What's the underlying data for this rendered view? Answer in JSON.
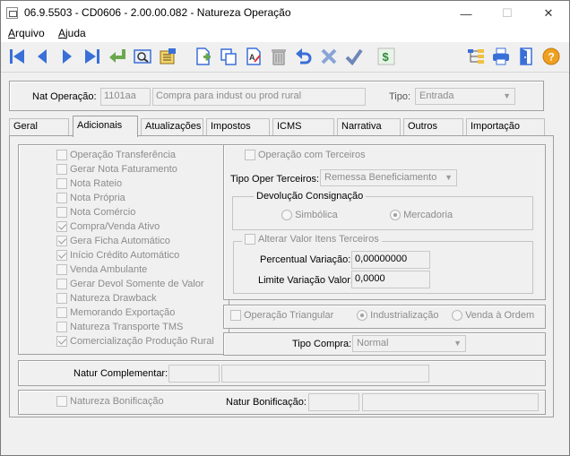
{
  "window": {
    "title": "06.9.5503 - CD0606 - 2.00.00.082 - Natureza Operação",
    "minimize": "—",
    "maximize": "☐",
    "close": "✕"
  },
  "menu": [
    {
      "label": "Arquivo",
      "underline": "A",
      "rest": "rquivo"
    },
    {
      "label": "Ajuda",
      "underline": "A",
      "rest": "juda"
    }
  ],
  "header": {
    "nat_label": "Nat Operação:",
    "nat_code": "1101aa",
    "nat_desc": "Compra para indust ou prod rural",
    "tipo_label": "Tipo:",
    "tipo_value": "Entrada"
  },
  "tabs": [
    "Geral",
    "Adicionais",
    "Atualizações",
    "Impostos",
    "ICMS",
    "Narrativa",
    "Outros",
    "Importação"
  ],
  "active_tab": "Adicionais",
  "checks_left": [
    {
      "label": "Operação Transferência",
      "checked": false
    },
    {
      "label": "Gerar Nota Faturamento",
      "checked": false
    },
    {
      "label": "Nota Rateio",
      "checked": false
    },
    {
      "label": "Nota Própria",
      "checked": false
    },
    {
      "label": "Nota Comércio",
      "checked": false
    },
    {
      "label": "Compra/Venda Ativo",
      "checked": true
    },
    {
      "label": "Gera Ficha Automático",
      "checked": true
    },
    {
      "label": "Início Crédito Automático",
      "checked": true
    },
    {
      "label": "Venda Ambulante",
      "checked": false
    },
    {
      "label": "Gerar Devol Somente de Valor",
      "checked": false
    },
    {
      "label": "Natureza Drawback",
      "checked": false
    },
    {
      "label": "Memorando Exportação",
      "checked": false
    },
    {
      "label": "Natureza Transporte TMS",
      "checked": false
    },
    {
      "label": "Comercialização Produção Rural",
      "checked": true
    }
  ],
  "terceiros": {
    "check_label": "Operação com Terceiros",
    "tipo_label": "Tipo Oper Terceiros:",
    "tipo_value": "Remessa Beneficiamento",
    "devol_title": "Devolução Consignação",
    "radio_simbolica": "Simbólica",
    "radio_mercadoria": "Mercadoria",
    "alterar_label": "Alterar Valor Itens Terceiros",
    "percentual_label": "Percentual Variação:",
    "percentual_value": "0,00000000",
    "limite_label": "Limite Variação Valor:",
    "limite_value": "0,0000"
  },
  "triangular": {
    "check_label": "Operação Triangular",
    "radio_industrializacao": "Industrialização",
    "radio_venda": "Venda à Ordem"
  },
  "tipo_compra": {
    "label": "Tipo Compra:",
    "value": "Normal"
  },
  "complementar": {
    "label": "Natur Complementar:"
  },
  "bonificacao": {
    "check_label": "Natureza Bonificação",
    "natur_label": "Natur Bonificação:"
  },
  "colors": {
    "toolbar_blue": "#3a6fd8",
    "toolbar_green": "#6aa84f",
    "help_orange": "#f0a020"
  }
}
